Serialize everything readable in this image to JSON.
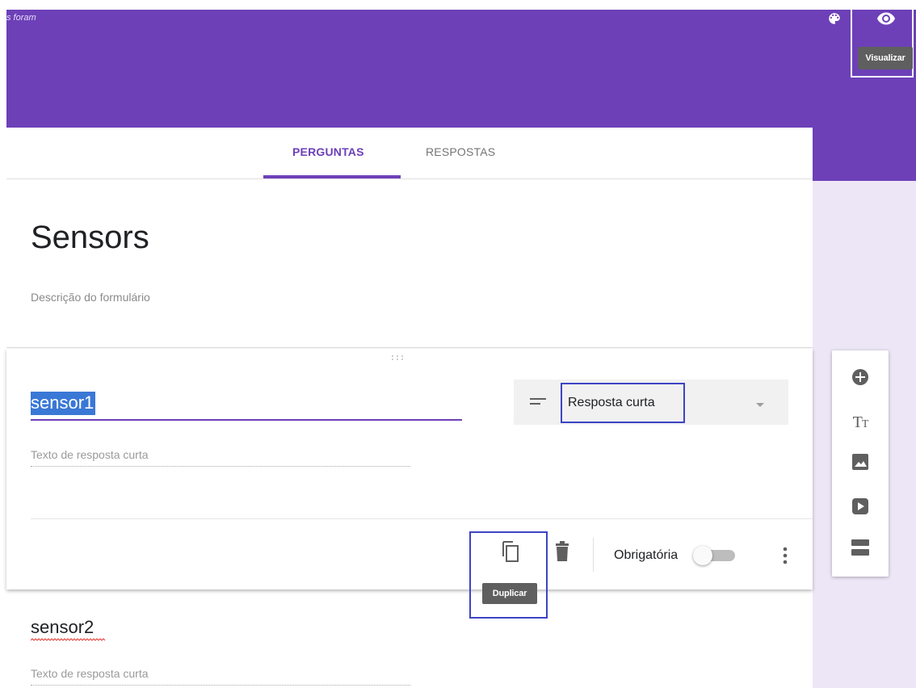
{
  "header": {
    "cutoff_text": "s foram",
    "palette_icon": "palette-icon",
    "preview_icon": "eye-icon",
    "preview_tooltip": "Visualizar",
    "color": "#6d40b8"
  },
  "tabs": {
    "questions": "PERGUNTAS",
    "responses": "RESPOSTAS",
    "active": "PERGUNTAS"
  },
  "form": {
    "title": "Sensors",
    "description_placeholder": "Descrição do formulário"
  },
  "questions": [
    {
      "title": "sensor1",
      "type": "Resposta curta",
      "answer_placeholder": "Texto de resposta curta",
      "required_label": "Obrigatória",
      "required": false,
      "duplicate_tooltip": "Duplicar",
      "icons": [
        "duplicate-icon",
        "trash-icon",
        "more-vert-icon"
      ]
    },
    {
      "title": "sensor2",
      "answer_placeholder": "Texto de resposta curta"
    }
  ],
  "toolbar": {
    "tools": [
      "add-question-icon",
      "add-title-icon",
      "add-image-icon",
      "add-video-icon",
      "add-section-icon"
    ],
    "title_glyph": "T",
    "title_glyph_small": "T"
  },
  "colors": {
    "accent": "#6d40b8",
    "highlight_box": "#3d44c4",
    "selection": "#3a78d6",
    "side_panel": "#ece6f6"
  }
}
